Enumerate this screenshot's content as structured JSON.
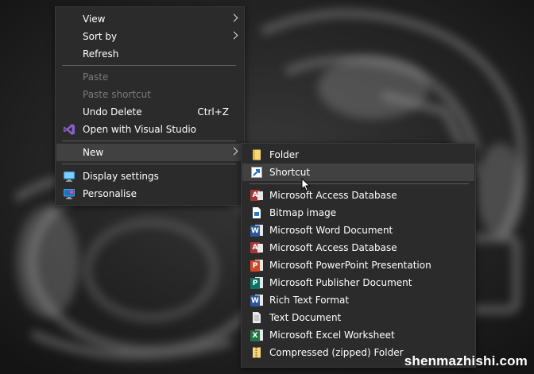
{
  "main_menu": {
    "items": [
      {
        "label": "View"
      },
      {
        "label": "Sort by"
      },
      {
        "label": "Refresh"
      },
      {
        "label": "Paste"
      },
      {
        "label": "Paste shortcut"
      },
      {
        "label": "Undo Delete",
        "shortcut": "Ctrl+Z"
      },
      {
        "label": "Open with Visual Studio"
      },
      {
        "label": "New"
      },
      {
        "label": "Display settings"
      },
      {
        "label": "Personalise"
      }
    ]
  },
  "new_submenu": {
    "items": [
      {
        "label": "Folder"
      },
      {
        "label": "Shortcut"
      },
      {
        "label": "Microsoft Access Database"
      },
      {
        "label": "Bitmap image"
      },
      {
        "label": "Microsoft Word Document"
      },
      {
        "label": "Microsoft Access Database"
      },
      {
        "label": "Microsoft PowerPoint Presentation"
      },
      {
        "label": "Microsoft Publisher Document"
      },
      {
        "label": "Rich Text Format"
      },
      {
        "label": "Text Document"
      },
      {
        "label": "Microsoft Excel Worksheet"
      },
      {
        "label": "Compressed (zipped) Folder"
      }
    ]
  },
  "watermark": "shenmazhishi.com",
  "icons": {
    "visual_studio": "visual-studio-icon",
    "display": "monitor-icon",
    "personalise": "personalise-icon",
    "folder": "folder-icon"
  },
  "colors": {
    "menu_bg": "#2b2b2b",
    "highlight": "#414141",
    "disabled_text": "#7a7a7a",
    "access": "#a4373a",
    "word": "#2b579a",
    "powerpoint": "#d24726",
    "publisher": "#077568",
    "excel": "#217346",
    "folder": "#f8d775"
  }
}
